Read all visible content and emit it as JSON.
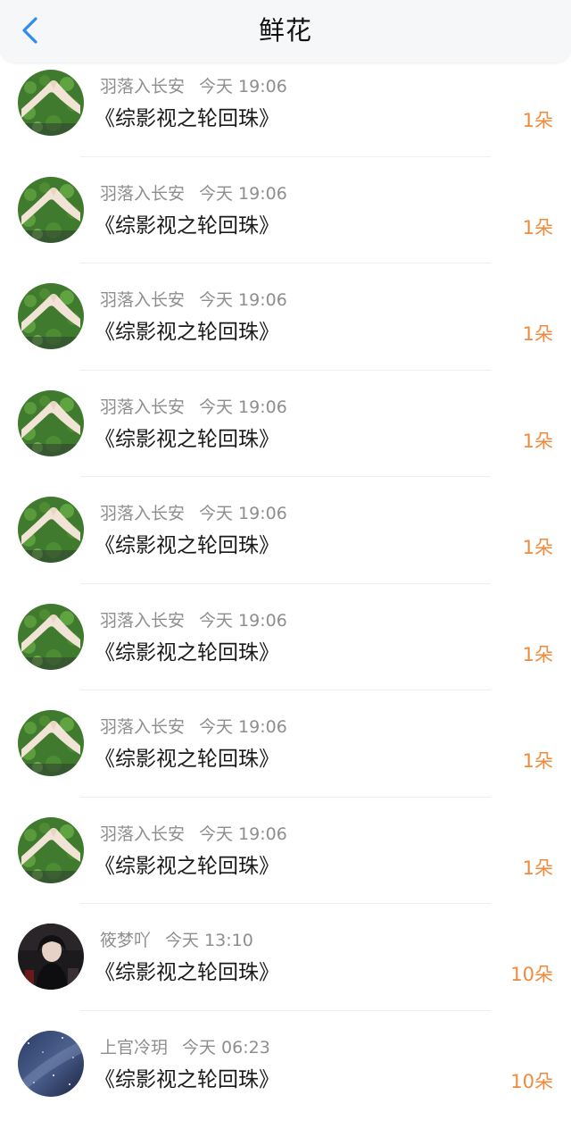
{
  "header": {
    "title": "鲜花"
  },
  "rows": [
    {
      "name": "羽落入长安",
      "time": "今天 19:06",
      "book": "《综影视之轮回珠》",
      "count": "1朵",
      "avatar": "hands-grass"
    },
    {
      "name": "羽落入长安",
      "time": "今天 19:06",
      "book": "《综影视之轮回珠》",
      "count": "1朵",
      "avatar": "hands-grass"
    },
    {
      "name": "羽落入长安",
      "time": "今天 19:06",
      "book": "《综影视之轮回珠》",
      "count": "1朵",
      "avatar": "hands-grass"
    },
    {
      "name": "羽落入长安",
      "time": "今天 19:06",
      "book": "《综影视之轮回珠》",
      "count": "1朵",
      "avatar": "hands-grass"
    },
    {
      "name": "羽落入长安",
      "time": "今天 19:06",
      "book": "《综影视之轮回珠》",
      "count": "1朵",
      "avatar": "hands-grass"
    },
    {
      "name": "羽落入长安",
      "time": "今天 19:06",
      "book": "《综影视之轮回珠》",
      "count": "1朵",
      "avatar": "hands-grass"
    },
    {
      "name": "羽落入长安",
      "time": "今天 19:06",
      "book": "《综影视之轮回珠》",
      "count": "1朵",
      "avatar": "hands-grass"
    },
    {
      "name": "羽落入长安",
      "time": "今天 19:06",
      "book": "《综影视之轮回珠》",
      "count": "1朵",
      "avatar": "hands-grass"
    },
    {
      "name": "筱梦吖",
      "time": "今天 13:10",
      "book": "《综影视之轮回珠》",
      "count": "10朵",
      "avatar": "portrait-dark"
    },
    {
      "name": "上官冷玥",
      "time": "今天 06:23",
      "book": "《综影视之轮回珠》",
      "count": "10朵",
      "avatar": "starry-sky"
    }
  ],
  "colors": {
    "accent_blue": "#2d8cf0",
    "count_orange": "#f08a3c",
    "meta_gray": "#8e8e8e"
  }
}
